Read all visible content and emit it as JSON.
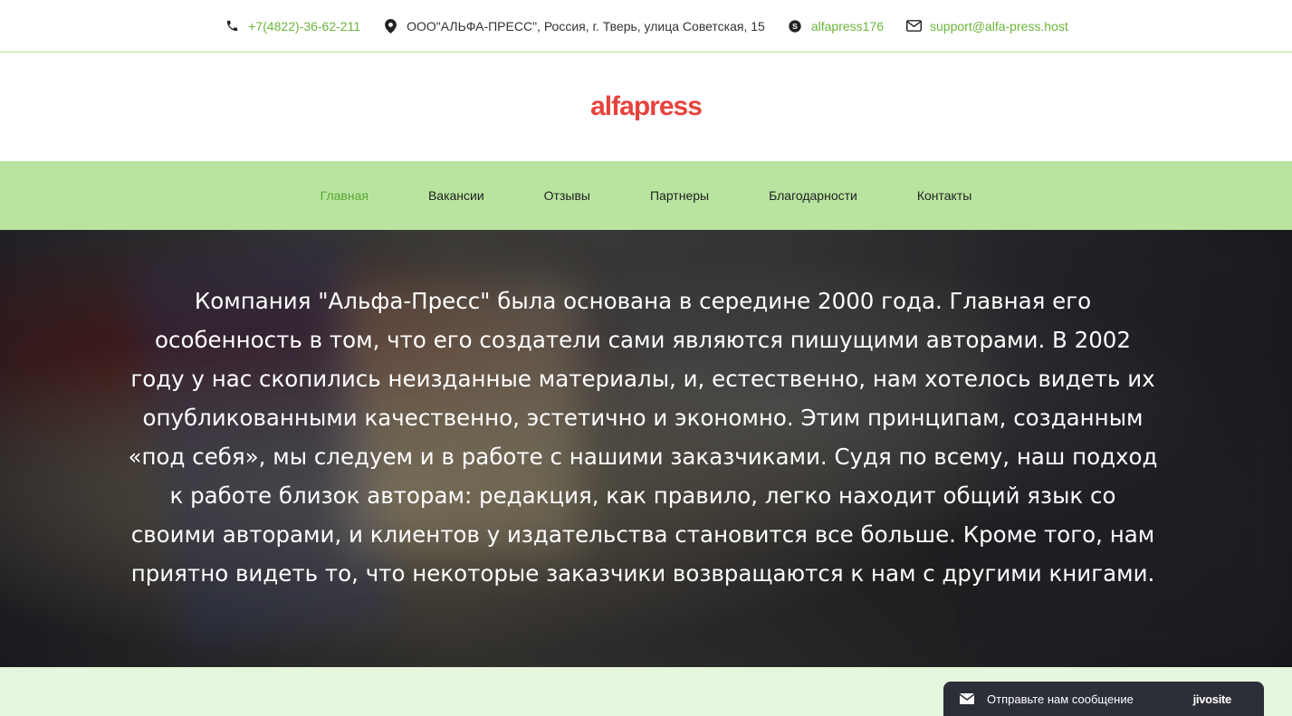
{
  "topbar": {
    "phone": "+7(4822)-36-62-211",
    "address": "ООО\"АЛЬФА-ПРЕСС\", Россия, г. Тверь, улица Советская, 15",
    "skype": "alfapress176",
    "email": "support@alfa-press.host"
  },
  "logo": {
    "text": "alfapress"
  },
  "nav": {
    "items": [
      {
        "label": "Главная"
      },
      {
        "label": "Вакансии"
      },
      {
        "label": "Отзывы"
      },
      {
        "label": "Партнеры"
      },
      {
        "label": "Благодарности"
      },
      {
        "label": "Контакты"
      }
    ]
  },
  "hero": {
    "text": "Компания \"Альфа-Пресс\" была основана в середине 2000 года. Главная его особенность в том, что его создатели сами являются пишущими авторами. В 2002 году у нас скопились неизданные материалы, и, естественно, нам хотелось видеть их опубликованными качественно, эстетично и экономно. Этим принципам, созданным «под себя», мы следуем и в работе с нашими заказчиками. Судя по всему, наш подход к работе близок авторам: редакция, как правило, легко находит общий язык со своими авторами, и клиентов у издательства становится все больше. Кроме того, нам приятно видеть то, что некоторые заказчики возвращаются к нам с другими книгами."
  },
  "chat": {
    "label": "Отправьте нам сообщение",
    "brand": "jivosite"
  },
  "colors": {
    "accent": "#6bb53a",
    "nav_bg": "#b8e49f",
    "logo": "#e8423c",
    "footer_bg": "#e6f6dc",
    "chat_bg": "#2c2e38"
  },
  "icons": [
    "phone-icon",
    "location-icon",
    "skype-icon",
    "mail-icon",
    "chat-mail-icon"
  ]
}
